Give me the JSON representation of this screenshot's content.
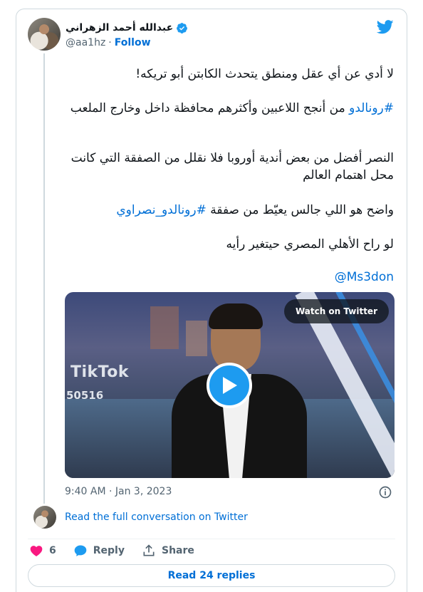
{
  "author": {
    "name": "عبدالله أحمد الزهراني",
    "handle": "@aa1hz",
    "separator": "·",
    "follow_label": "Follow"
  },
  "tweet": {
    "p1": "لا أدي عن أي عقل ومنطق يتحدث الكابتن أبو تريكه!",
    "p2_hashtag": "#رونالدو",
    "p2_rest": " من أنجح اللاعبين وأكثرهم محافظة داخل وخارج الملعب",
    "p3": "النصر أفضل من بعض أندية أوروبا فلا نقلل من الصفقة التي كانت محل اهتمام العالم",
    "p4_text": "واضح هو اللي جالس يعيّط من صفقة ",
    "p4_hashtag": "#رونالدو_نصراوي",
    "p5": "لو راح الأهلي المصري حيتغير رأيه",
    "mention": "@Ms3don"
  },
  "media": {
    "overlay_brand": "TikTok",
    "overlay_id": "50516",
    "watch_label": "Watch on Twitter"
  },
  "meta": {
    "timestamp": "9:40 AM · Jan 3, 2023"
  },
  "conversation": {
    "link_label": "Read the full conversation on Twitter"
  },
  "actions": {
    "like_count": "6",
    "reply_label": "Reply",
    "share_label": "Share"
  },
  "replies": {
    "button_label": "Read 24 replies"
  },
  "colors": {
    "accent": "#1d9bf0",
    "link": "#006fd6",
    "like": "#f91880",
    "muted": "#536471"
  }
}
